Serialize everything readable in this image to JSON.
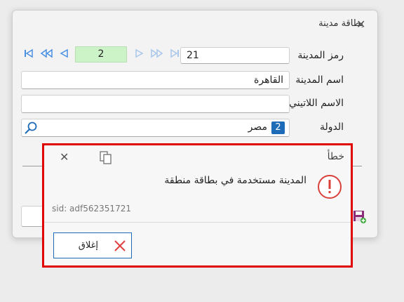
{
  "window": {
    "title": "بطاقة مدينة"
  },
  "form": {
    "city_code_label": "رمز المدينة",
    "city_code_value": "21",
    "page_number": "2",
    "city_name_label": "اسم المدينة",
    "city_name_value": "القاهرة",
    "latin_name_label": "الاسم اللاتيني",
    "latin_name_value": "",
    "country_label": "الدولة",
    "country_code": "2",
    "country_name": "مصر"
  },
  "error": {
    "title": "خطأ",
    "message": "المدينة مستخدمة في بطاقة منطقة",
    "sid": "sid: adf562351721",
    "close_label": "إغلاق",
    "highlight_color": "#e00000"
  },
  "icons": {
    "nav_first": "first-record-icon",
    "nav_prev_page": "previous-page-icon",
    "nav_prev": "previous-record-icon",
    "nav_next": "next-record-icon",
    "nav_next_page": "next-page-icon",
    "nav_last": "last-record-icon",
    "search": "search-icon",
    "copy": "copy-icon",
    "warning": "exclamation-icon",
    "close": "close-icon",
    "save": "save-icon"
  }
}
